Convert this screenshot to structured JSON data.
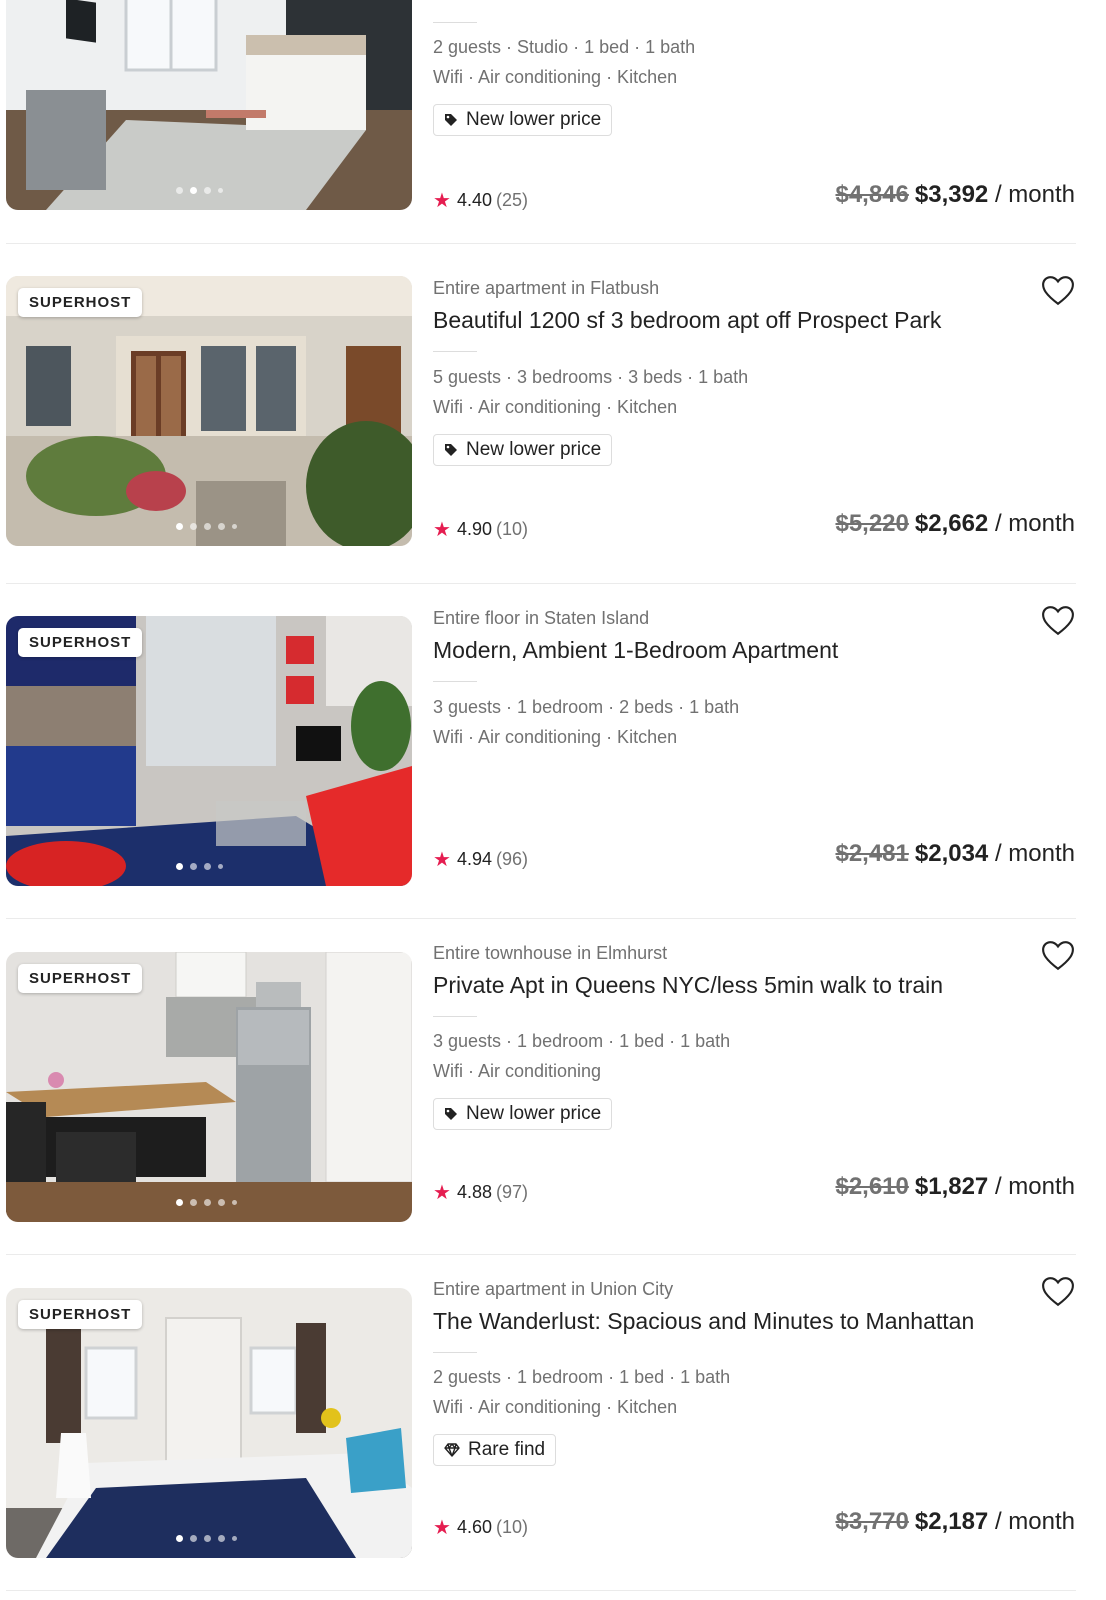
{
  "listings": [
    {
      "subtitle": "",
      "title": "",
      "amenities_line1": "2 guests · Studio · 1 bed · 1 bath",
      "amenities_line2": "Wifi · Air conditioning · Kitchen",
      "tag": "New lower price",
      "tag_icon": "price-tag-icon",
      "rating": "4.40",
      "reviews": "(25)",
      "old_price": "$4,846",
      "new_price": "$3,392",
      "per": " / month",
      "superhost": "",
      "photo_theme": "bedroom"
    },
    {
      "subtitle": "Entire apartment in Flatbush",
      "title": "Beautiful 1200 sf 3 bedroom apt off Prospect Park",
      "amenities_line1": "5 guests · 3 bedrooms · 3 beds · 1 bath",
      "amenities_line2": "Wifi · Air conditioning · Kitchen",
      "tag": "New lower price",
      "tag_icon": "price-tag-icon",
      "rating": "4.90",
      "reviews": "(10)",
      "old_price": "$5,220",
      "new_price": "$2,662",
      "per": " / month",
      "superhost": "SUPERHOST",
      "photo_theme": "facade"
    },
    {
      "subtitle": "Entire floor in Staten Island",
      "title": "Modern, Ambient 1-Bedroom Apartment",
      "amenities_line1": "3 guests · 1 bedroom · 2 beds · 1 bath",
      "amenities_line2": "Wifi · Air conditioning · Kitchen",
      "tag": "",
      "tag_icon": "",
      "rating": "4.94",
      "reviews": "(96)",
      "old_price": "$2,481",
      "new_price": "$2,034",
      "per": " / month",
      "superhost": "SUPERHOST",
      "photo_theme": "living"
    },
    {
      "subtitle": "Entire townhouse in Elmhurst",
      "title": "Private Apt in Queens NYC/less 5min walk to train",
      "amenities_line1": "3 guests · 1 bedroom · 1 bed · 1 bath",
      "amenities_line2": "Wifi · Air conditioning",
      "tag": "New lower price",
      "tag_icon": "price-tag-icon",
      "rating": "4.88",
      "reviews": "(97)",
      "old_price": "$2,610",
      "new_price": "$1,827",
      "per": " / month",
      "superhost": "SUPERHOST",
      "photo_theme": "kitchen"
    },
    {
      "subtitle": "Entire apartment in Union City",
      "title": "The Wanderlust: Spacious and Minutes to Manhattan",
      "amenities_line1": "2 guests · 1 bedroom · 1 bed · 1 bath",
      "amenities_line2": "Wifi · Air conditioning · Kitchen",
      "tag": "Rare find",
      "tag_icon": "diamond-icon",
      "rating": "4.60",
      "reviews": "(10)",
      "old_price": "$3,770",
      "new_price": "$2,187",
      "per": " / month",
      "superhost": "SUPERHOST",
      "photo_theme": "bedroom2"
    }
  ],
  "colors": {
    "star": "#e51d50",
    "muted": "#717171",
    "text": "#222222"
  }
}
